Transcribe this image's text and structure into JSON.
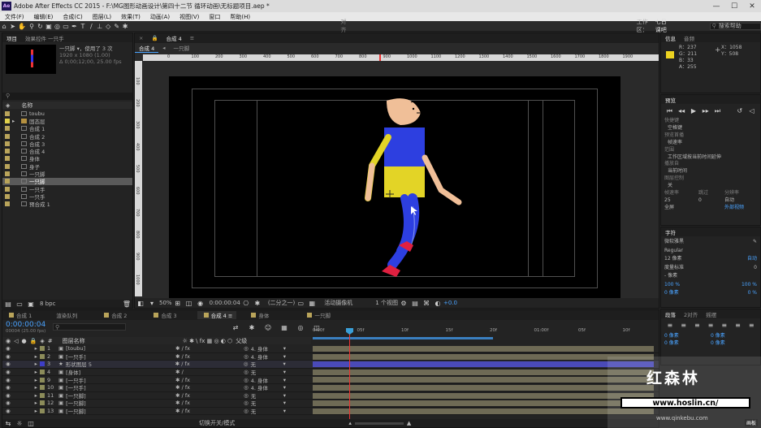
{
  "titlebar": {
    "logo": "Ae",
    "title": "Adobe After Effects CC 2015 - F:\\MG图形动画设计\\第四十二节 循环动画\\无标题项目.aep *",
    "controls": [
      "minimize",
      "maximize",
      "close"
    ]
  },
  "menu": [
    "文件(F)",
    "编辑(E)",
    "合成(C)",
    "图层(L)",
    "效果(T)",
    "动画(A)",
    "视图(V)",
    "窗口",
    "帮助(H)"
  ],
  "toolbar": {
    "snap_label": "对齐",
    "workspace_label": "工作区：",
    "workspace_value": "七日课吧",
    "search_label": "搜索帮助"
  },
  "project": {
    "tab_project": "项目",
    "tab_effects": "效果控件 一只手",
    "comp_name": "一只脚 ▾，使用了 3 次",
    "comp_res": "1920 x 1080 (1.00)",
    "comp_dur": "Δ 0;00;12;00, 25.00 fps",
    "col_name": "名称",
    "items": [
      "toubu",
      "固态层",
      "合成 1",
      "合成 2",
      "合成 3",
      "合成 4",
      "身体",
      "身子",
      "一只脚",
      "一只脚",
      "一只手",
      "一只手",
      "预合成 1"
    ],
    "bpc": "8 bpc"
  },
  "comp": {
    "tabs": [
      "合成 4",
      "一只脚"
    ],
    "comp_header": "合成 4",
    "ruler": [
      "0",
      "100",
      "200",
      "300",
      "400",
      "500",
      "600",
      "700",
      "800",
      "900",
      "1000",
      "1100",
      "1200",
      "1300",
      "1400",
      "1500",
      "1600",
      "1700",
      "1800",
      "1900"
    ],
    "vruler": [
      "100",
      "200",
      "300",
      "400",
      "500",
      "600",
      "700",
      "800",
      "900",
      "1000"
    ],
    "zoom": "50%",
    "timecode": "0:00:00:04",
    "resolution": "(二分之一)",
    "camera": "活动摄像机",
    "views": "1 个视图",
    "exposure": "+0.0"
  },
  "info": {
    "tab_info": "信息",
    "tab_audio": "音频",
    "r": "R：237",
    "g": "G：211",
    "b": "B：33",
    "a": "A：255",
    "x": "X：1058",
    "y": "Y：508",
    "swatch": "#edd321"
  },
  "preview": {
    "tab": "预览",
    "shortcut_label": "快捷键",
    "shortcut_value": "空格键",
    "include_label": "预览首播",
    "include_value": "帧速率",
    "range_label": "范围",
    "range_value": "工作区域按当前时间延伸",
    "play_from_label": "播放自",
    "play_from_value": "当前时间",
    "playback_label": "图层控制",
    "playback_value": "关",
    "frame_rate_label": "帧速率",
    "skip_label": "跳过",
    "res_label": "分辨率",
    "frame_rate_value": "25",
    "skip_value": "0",
    "res_value": "自动",
    "fullscreen_label": "全屏",
    "external_label": "外部视频"
  },
  "character": {
    "tab": "字符",
    "font": "微软雅黑",
    "style": "Regular",
    "size": "12 像素",
    "auto": "自动",
    "metrics": "度量标准",
    "tracking": "0",
    "px_label": "- 像素",
    "pct1": "100 %",
    "pct2": "100 %",
    "baseline": "0 像素",
    "tsume": "0 %"
  },
  "paragraph": {
    "tab_para": "段落",
    "tab_2": "2对齐",
    "tab_3": "摇摆",
    "indent1": "0 像素",
    "indent2": "0 像素",
    "indent3": "0 像素",
    "indent4": "0 像素"
  },
  "timeline": {
    "tabs": [
      "合成 1",
      "渲染队列",
      "合成 2",
      "合成 3",
      "合成 4",
      "身体",
      "一只脚"
    ],
    "timecode": "0:00:00:04",
    "fps": "00004 (25.00 fps)",
    "col_name": "图层名称",
    "col_parent": "父级",
    "ticks": [
      "0:00f",
      "05f",
      "10f",
      "15f",
      "20f",
      "01:00f",
      "05f",
      "10f"
    ],
    "layers": [
      {
        "n": "1",
        "name": "[toubu]",
        "parent": "4. 身体",
        "color": "#8c8c5a"
      },
      {
        "n": "2",
        "name": "[一只手]",
        "parent": "4. 身体",
        "color": "#8c8c5a"
      },
      {
        "n": "3",
        "name": "形状图层 5",
        "parent": "无",
        "color": "#3e3ec6"
      },
      {
        "n": "4",
        "name": "[身体]",
        "parent": "无",
        "color": "#8c8c5a"
      },
      {
        "n": "9",
        "name": "[一只手]",
        "parent": "4. 身体",
        "color": "#8c8c5a"
      },
      {
        "n": "10",
        "name": "[一只手]",
        "parent": "4. 身体",
        "color": "#8c8c5a"
      },
      {
        "n": "11",
        "name": "[一只脚]",
        "parent": "无",
        "color": "#8c8c5a"
      },
      {
        "n": "12",
        "name": "[一只脚]",
        "parent": "无",
        "color": "#8c8c5a"
      },
      {
        "n": "13",
        "name": "[一只脚]",
        "parent": "无",
        "color": "#8c8c5a"
      }
    ],
    "switch_mode": "切换开关/模式"
  },
  "watermark": {
    "brand": "红森林",
    "url": "www.hoslin.cn/",
    "site": "www.qinkebu.com"
  },
  "statusbar": {
    "right": "画板"
  }
}
